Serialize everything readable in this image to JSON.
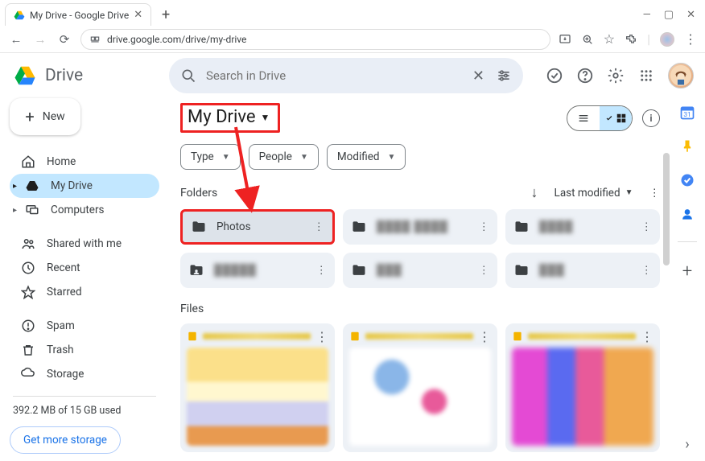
{
  "browser": {
    "tab_title": "My Drive - Google Drive",
    "url": "drive.google.com/drive/my-drive"
  },
  "app": {
    "product_name": "Drive",
    "search_placeholder": "Search in Drive"
  },
  "sidebar": {
    "new_label": "New",
    "items": [
      {
        "label": "Home"
      },
      {
        "label": "My Drive"
      },
      {
        "label": "Computers"
      },
      {
        "label": "Shared with me"
      },
      {
        "label": "Recent"
      },
      {
        "label": "Starred"
      },
      {
        "label": "Spam"
      },
      {
        "label": "Trash"
      },
      {
        "label": "Storage"
      }
    ],
    "storage_used": "392.2 MB of 15 GB used",
    "storage_cta": "Get more storage"
  },
  "main": {
    "title": "My Drive",
    "chips": [
      {
        "label": "Type"
      },
      {
        "label": "People"
      },
      {
        "label": "Modified"
      }
    ],
    "folders_label": "Folders",
    "sort_label": "Last modified",
    "folders": [
      {
        "name": "Photos",
        "highlighted": true
      },
      {
        "name": "████ ████",
        "blurred": true
      },
      {
        "name": "████",
        "blurred": true
      },
      {
        "name": "█████",
        "blurred": true
      },
      {
        "name": "███",
        "blurred": true
      },
      {
        "name": "███",
        "blurred": true
      }
    ],
    "files_label": "Files"
  }
}
